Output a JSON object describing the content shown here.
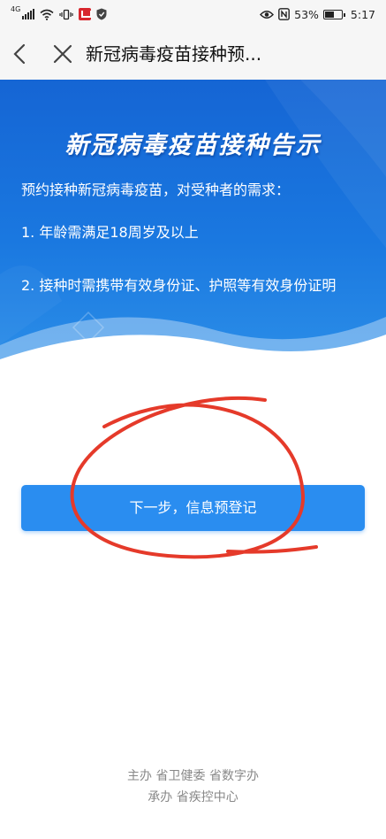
{
  "status_bar": {
    "network": "4G",
    "battery_percent": "53%",
    "time": "5:17",
    "icons": [
      "signal-icon",
      "wifi-icon",
      "vibrate-icon",
      "app-badge-icon",
      "shield-icon",
      "eye-icon",
      "nfc-icon",
      "battery-icon"
    ]
  },
  "nav": {
    "title": "新冠病毒疫苗接种预...",
    "back_icon": "chevron-left-icon",
    "close_icon": "close-icon"
  },
  "hero": {
    "title": "新冠病毒疫苗接种告示",
    "intro": "预约接种新冠病毒疫苗，对受种者的需求：",
    "items": [
      "1. 年龄需满足18周岁及以上",
      "2. 接种时需携带有效身份证、护照等有效身份证明"
    ],
    "colors": {
      "top": "#1565d4",
      "bottom": "#2c8fe8"
    }
  },
  "main": {
    "next_button_label": "下一步，信息预登记",
    "button_color": "#2a8df0",
    "annotation_color": "#e53a2a"
  },
  "footer": {
    "organizer": "主办 省卫健委 省数字办",
    "undertaker": "承办 省疾控中心"
  }
}
